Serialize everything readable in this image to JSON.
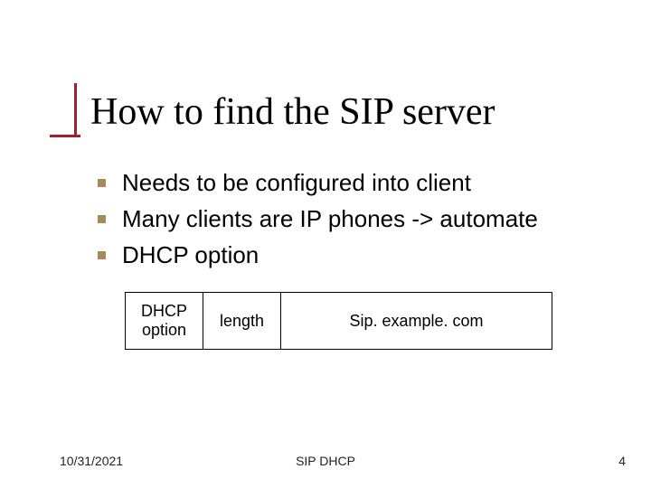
{
  "title": "How to find the SIP server",
  "bullets": [
    "Needs to be configured into client",
    "Many clients are IP phones -> automate",
    "DHCP option"
  ],
  "table": {
    "cells": [
      "DHCP option",
      "length",
      "Sip. example. com"
    ]
  },
  "footer": {
    "date": "10/31/2021",
    "center": "SIP DHCP",
    "page": "4"
  }
}
